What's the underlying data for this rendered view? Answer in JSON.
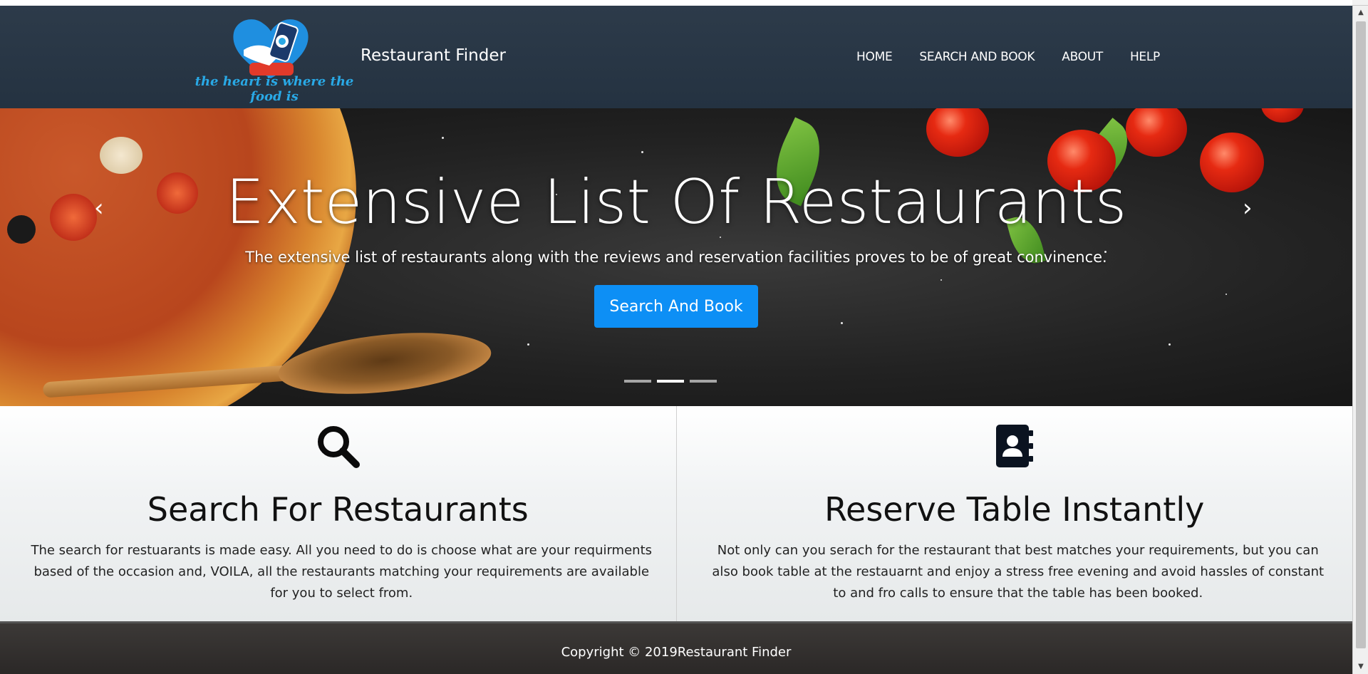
{
  "navbar": {
    "tagline": "the heart is where the food is",
    "brand": "Restaurant Finder",
    "links": [
      "HOME",
      "SEARCH AND BOOK",
      "ABOUT",
      "HELP"
    ]
  },
  "hero": {
    "title": "Extensive List Of Restaurants",
    "subtitle": "The extensive list of restaurants along with the reviews and reservation facilities proves to be of great convinence.",
    "button_label": "Search And Book",
    "prev_glyph": "‹",
    "next_glyph": "›",
    "slide_count": 3,
    "active_slide": 2
  },
  "features": [
    {
      "icon": "search-icon",
      "title": "Search For Restaurants",
      "text": "The search for restuarants is made easy. All you need to do is choose what are your requirments based of the occasion and, VOILA, all the restaurants matching your requirements are available for you to select from."
    },
    {
      "icon": "address-book-icon",
      "title": "Reserve Table Instantly",
      "text": "Not only can you serach for the restaurant that best matches your requirements, but you can also book table at the restauarnt and enjoy a stress free evening and avoid hassles of constant to and fro calls to ensure that the table has been booked."
    }
  ],
  "footer": {
    "copyright": "Copyright © 2019Restaurant Finder"
  },
  "colors": {
    "navbar_bg": "#2d3b4a",
    "button_blue": "#0d8ff5",
    "tagline_blue": "#29a9e6",
    "footer_bg": "#3c3937"
  }
}
